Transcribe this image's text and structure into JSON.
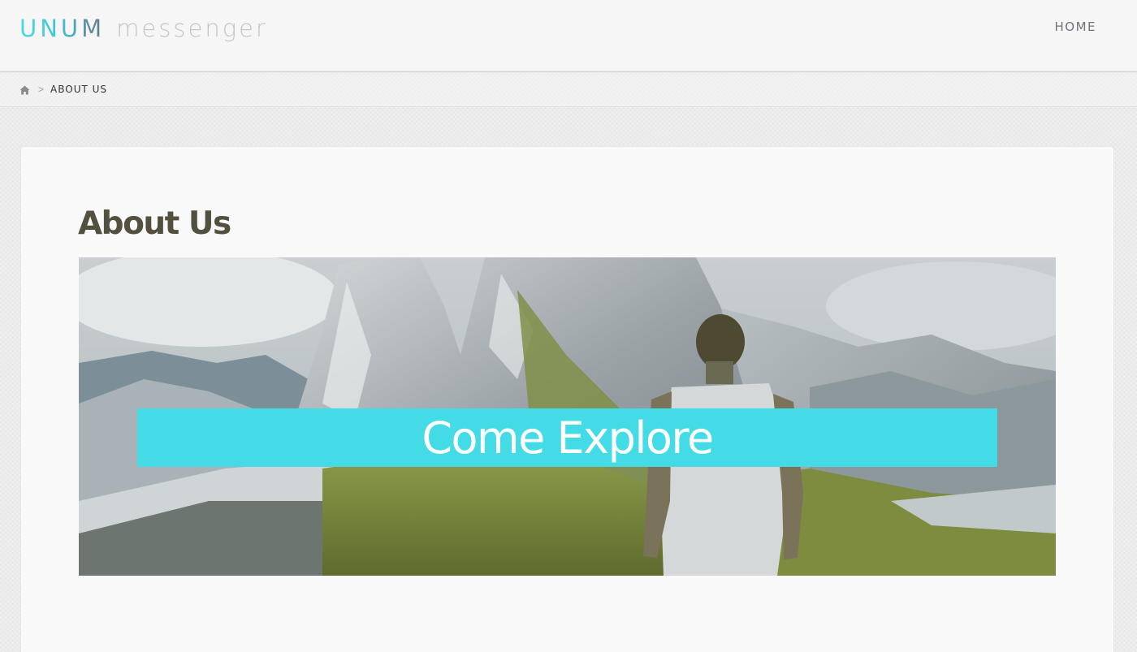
{
  "header": {
    "logo_brand": "UNUM",
    "logo_product": "messenger",
    "nav": {
      "home": "HOME"
    }
  },
  "breadcrumb": {
    "home_icon": "home-icon",
    "separator": ">",
    "current": "ABOUT US"
  },
  "main": {
    "title": "About Us",
    "banner": {
      "caption": "Come Explore",
      "image": "mountain-hiker-photo"
    }
  },
  "colors": {
    "accent": "#43dbe6",
    "title": "#53503f",
    "nav": "#6b7580"
  }
}
